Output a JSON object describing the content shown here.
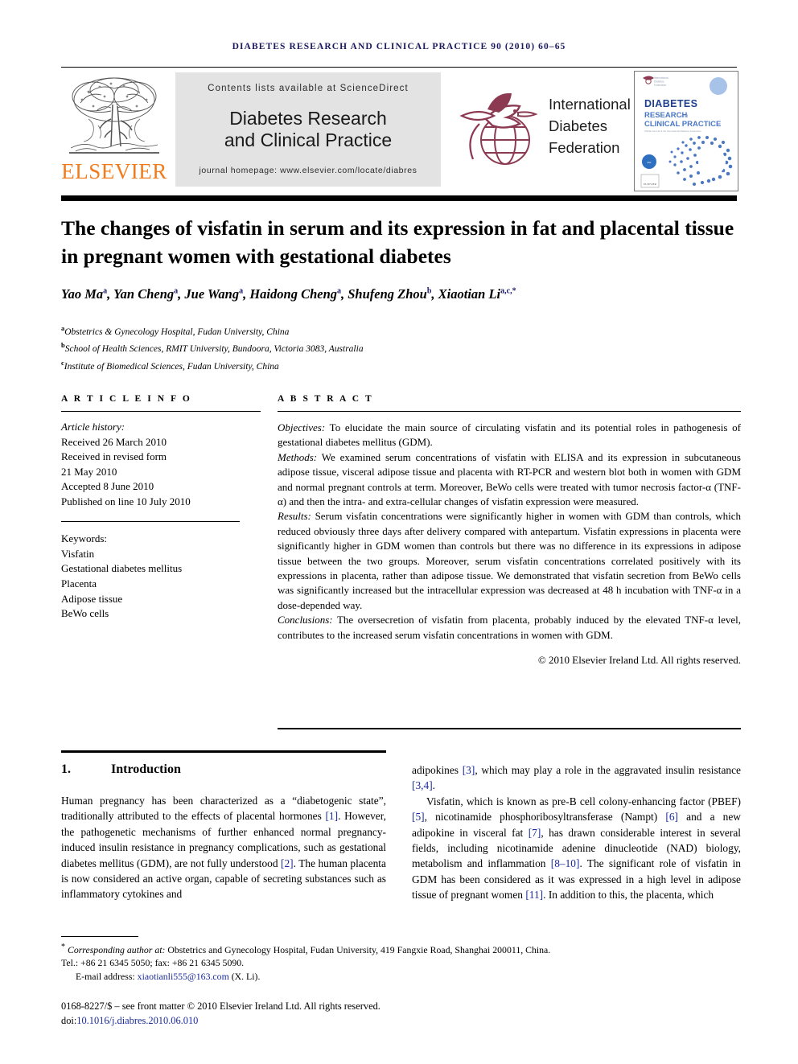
{
  "running_head": "Diabetes Research and Clinical Practice 90 (2010) 60–65",
  "masthead": {
    "publisher": "ELSEVIER",
    "contents_line": "Contents lists available at ScienceDirect",
    "journal_title_line1": "Diabetes Research",
    "journal_title_line2": "and Clinical Practice",
    "homepage": "journal homepage: www.elsevier.com/locate/diabres",
    "society_line1": "International",
    "society_line2": "Diabetes",
    "society_line3": "Federation",
    "cover": {
      "line1": "DIABETES",
      "line2": "RESEARCH and",
      "line3": "CLINICAL PRACTICE",
      "tagline": "Official Journal of the International Diabetes Federation"
    }
  },
  "article": {
    "title": "The changes of visfatin in serum and its expression in fat and placental tissue in pregnant women with gestational diabetes",
    "authors": [
      {
        "name": "Yao Ma",
        "sup": "a"
      },
      {
        "name": "Yan Cheng",
        "sup": "a"
      },
      {
        "name": "Jue Wang",
        "sup": "a"
      },
      {
        "name": "Haidong Cheng",
        "sup": "a"
      },
      {
        "name": "Shufeng Zhou",
        "sup": "b"
      },
      {
        "name": "Xiaotian Li",
        "sup": "a,c,*"
      }
    ],
    "affiliations": [
      {
        "mark": "a",
        "text": "Obstetrics & Gynecology Hospital, Fudan University, China"
      },
      {
        "mark": "b",
        "text": "School of Health Sciences, RMIT University, Bundoora, Victoria 3083, Australia"
      },
      {
        "mark": "c",
        "text": "Institute of Biomedical Sciences, Fudan University, China"
      }
    ]
  },
  "article_info": {
    "heading": "A R T I C L E   I N F O",
    "history_label": "Article history:",
    "history": [
      "Received 26 March 2010",
      "Received in revised form",
      "21 May 2010",
      "Accepted 8 June 2010",
      "Published on line 10 July 2010"
    ],
    "keywords_label": "Keywords:",
    "keywords": [
      "Visfatin",
      "Gestational diabetes mellitus",
      "Placenta",
      "Adipose tissue",
      "BeWo cells"
    ]
  },
  "abstract": {
    "heading": "A B S T R A C T",
    "objectives_label": "Objectives:",
    "objectives": " To elucidate the main source of circulating visfatin and its potential roles in pathogenesis of gestational diabetes mellitus (GDM).",
    "methods_label": "Methods:",
    "methods": " We examined serum concentrations of visfatin with ELISA and its expression in subcutaneous adipose tissue, visceral adipose tissue and placenta with RT-PCR and western blot both in women with GDM and normal pregnant controls at term. Moreover, BeWo cells were treated with tumor necrosis factor-α (TNF-α) and then the intra- and extra-cellular changes of visfatin expression were measured.",
    "results_label": "Results:",
    "results": " Serum visfatin concentrations were significantly higher in women with GDM than controls, which reduced obviously three days after delivery compared with antepartum. Visfatin expressions in placenta were significantly higher in GDM women than controls but there was no difference in its expressions in adipose tissue between the two groups. Moreover, serum visfatin concentrations correlated positively with its expressions in placenta, rather than adipose tissue. We demonstrated that visfatin secretion from BeWo cells was significantly increased but the intracellular expression was decreased at 48 h incubation with TNF-α in a dose-depended way.",
    "conclusions_label": "Conclusions:",
    "conclusions": " The oversecretion of visfatin from placenta, probably induced by the elevated TNF-α level, contributes to the increased serum visfatin concentrations in women with GDM.",
    "copyright": "© 2010 Elsevier Ireland Ltd. All rights reserved."
  },
  "sections": {
    "intro_number": "1.",
    "intro_title": "Introduction",
    "left_p1_a": "Human pregnancy has been characterized as a “diabetogenic state”, traditionally attributed to the effects of placental hormones ",
    "left_cite1": "[1]",
    "left_p1_b": ". However, the pathogenetic mechanisms of further enhanced normal pregnancy-induced insulin resistance in pregnancy complications, such as gestational diabetes mellitus (GDM), are not fully understood ",
    "left_cite2": "[2]",
    "left_p1_c": ". The human placenta is now considered an active organ, capable of secreting substances such as inflammatory cytokines and",
    "right_p1_a": "adipokines ",
    "right_cite1": "[3]",
    "right_p1_b": ", which may play a role in the aggravated insulin resistance ",
    "right_cite2": "[3,4]",
    "right_p1_c": ".",
    "right_p2_a": "Visfatin, which is known as pre-B cell colony-enhancing factor (PBEF) ",
    "right_cite3": "[5]",
    "right_p2_b": ", nicotinamide phosphoribosyltransferase (Nampt) ",
    "right_cite4": "[6]",
    "right_p2_c": " and a new adipokine in visceral fat ",
    "right_cite5": "[7]",
    "right_p2_d": ", has drawn considerable interest in several fields, including nicotinamide adenine dinucleotide (NAD) biology, metabolism and inflammation ",
    "right_cite6": "[8–10]",
    "right_p2_e": ". The significant role of visfatin in GDM has been considered as it was expressed in a high level in adipose tissue of pregnant women ",
    "right_cite7": "[11]",
    "right_p2_f": ". In addition to this, the placenta, which"
  },
  "footnote": {
    "corresponding_label": "Corresponding author at:",
    "corresponding_text": " Obstetrics and Gynecology Hospital, Fudan University, 419 Fangxie Road, Shanghai 200011, China.",
    "tel_line": "Tel.: +86 21 6345 5050; fax: +86 21 6345 5090.",
    "email_label": "E-mail address:",
    "email": "xiaotianli555@163.com",
    "email_suffix": " (X. Li).",
    "issn_line": "0168-8227/$ – see front matter © 2010 Elsevier Ireland Ltd. All rights reserved.",
    "doi_label": "doi:",
    "doi": "10.1016/j.diabres.2010.06.010"
  },
  "colors": {
    "elsevier_orange": "#F07C1E",
    "running_head_navy": "#1a1a5e",
    "citation_blue": "#1a2b9c",
    "idf_maroon": "#8c3а52",
    "cover_blue": "#2e4a9e"
  }
}
